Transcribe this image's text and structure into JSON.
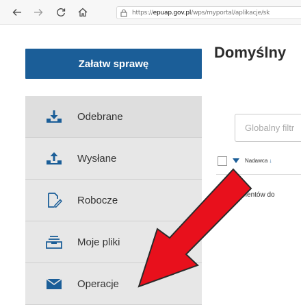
{
  "browser": {
    "url_prefix": "https://",
    "url_domain": "epuap.gov.pl",
    "url_path": "/wps/myportal/aplikacje/sk"
  },
  "cta": {
    "label": "Załatw sprawę"
  },
  "page": {
    "title": "Domyślny"
  },
  "sidebar": {
    "items": [
      {
        "label": "Odebrane",
        "icon": "inbox-download-icon"
      },
      {
        "label": "Wysłane",
        "icon": "outbox-upload-icon"
      },
      {
        "label": "Robocze",
        "icon": "draft-edit-icon"
      },
      {
        "label": "Moje pliki",
        "icon": "files-tray-icon"
      },
      {
        "label": "Operacje",
        "icon": "envelope-icon"
      }
    ]
  },
  "filter": {
    "placeholder": "Globalny filtr"
  },
  "table": {
    "sender_header": "Nadawca",
    "sort_arrow": "↓",
    "empty_message": "Brak elementów do"
  },
  "colors": {
    "primary": "#1b5e98",
    "sidebar_bg": "#e7e7e7",
    "annotation_arrow": "#e8101c"
  }
}
